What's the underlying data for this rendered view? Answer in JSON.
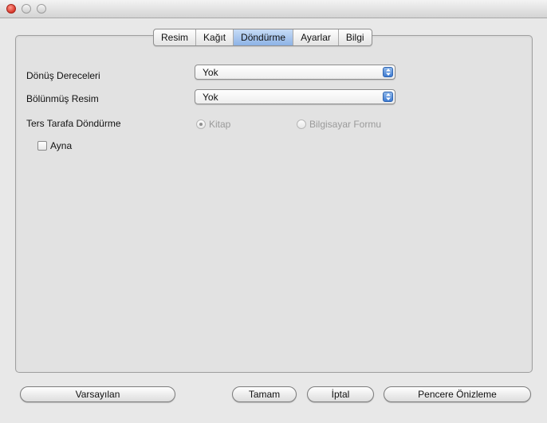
{
  "window": {
    "controls": [
      "close",
      "minimize",
      "zoom"
    ]
  },
  "tabs": [
    {
      "label": "Resim",
      "active": false
    },
    {
      "label": "Kağıt",
      "active": false
    },
    {
      "label": "Döndürme",
      "active": true
    },
    {
      "label": "Ayarlar",
      "active": false
    },
    {
      "label": "Bilgi",
      "active": false
    }
  ],
  "form": {
    "rotation_label": "Dönüş Dereceleri",
    "rotation_value": "Yok",
    "split_label": "Bölünmüş Resim",
    "split_value": "Yok",
    "reverse_label": "Ters Tarafa Döndürme",
    "reverse_options": [
      {
        "label": "Kitap",
        "checked": true,
        "enabled": false
      },
      {
        "label": "Bilgisayar Formu",
        "checked": false,
        "enabled": false
      }
    ],
    "mirror_label": "Ayna",
    "mirror_checked": false
  },
  "buttons": {
    "defaults": "Varsayılan",
    "ok": "Tamam",
    "cancel": "İptal",
    "preview": "Pencere Önizleme"
  },
  "colors": {
    "active_tab": "#8db3e6",
    "stepper": "#3d7bd2",
    "close_button": "#d9362a"
  }
}
